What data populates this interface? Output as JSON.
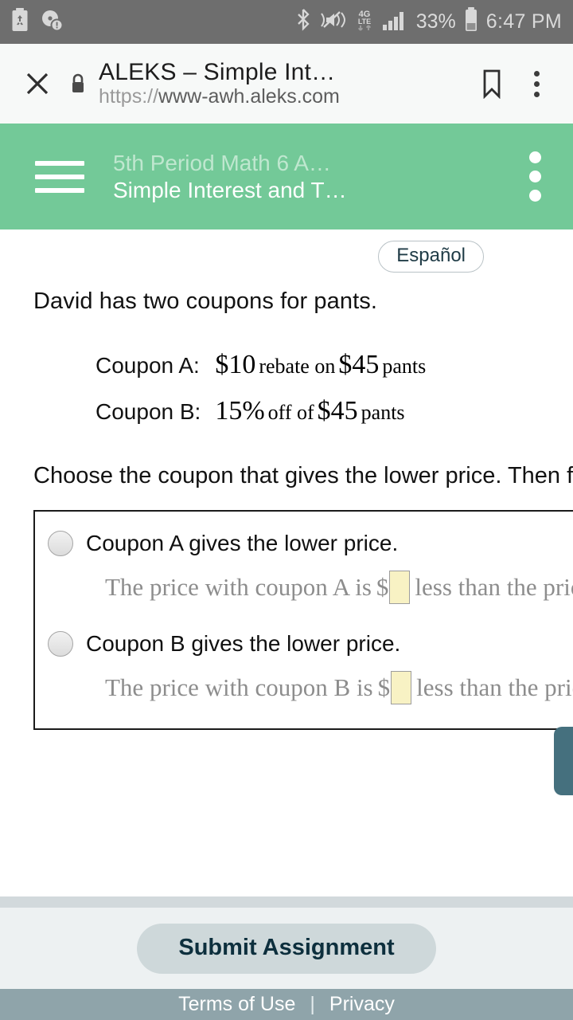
{
  "status_bar": {
    "time": "6:47 PM",
    "battery_percent": "33%",
    "network": "4G LTE",
    "left_icons": [
      "battery-saver-icon",
      "disc-warning-icon"
    ],
    "right_icons": [
      "bluetooth-icon",
      "volume-mute-vibrate-icon",
      "4g-lte-icon",
      "signal-bars-icon",
      "battery-icon"
    ],
    "background": "#6e6e6e"
  },
  "browser": {
    "close_label": "✕",
    "lock_icon": "lock-icon",
    "title": "ALEKS – Simple Int…",
    "url_scheme": "https://",
    "url_host": "www-awh.aleks.com",
    "bookmark_icon": "bookmark-icon",
    "menu_icon": "kebab-menu-icon",
    "background": "#f7f9f8"
  },
  "app_header": {
    "menu_icon": "hamburger-menu-icon",
    "course": "5th Period Math 6 A…",
    "assignment": "Simple Interest and T…",
    "overflow_icon": "kebab-menu-icon",
    "background": "#73c998"
  },
  "toolbar": {
    "espanol_label": "Español"
  },
  "problem": {
    "intro": "David has two coupons for pants.",
    "coupons": [
      {
        "label": "Coupon A:",
        "parts": [
          {
            "text": "$10",
            "size": "big"
          },
          {
            "text": "rebate on",
            "size": "sml"
          },
          {
            "text": "$45",
            "size": "big"
          },
          {
            "text": "pants",
            "size": "sml"
          }
        ]
      },
      {
        "label": "Coupon B:",
        "parts": [
          {
            "text": "15%",
            "size": "big"
          },
          {
            "text": "off of",
            "size": "sml"
          },
          {
            "text": "$45",
            "size": "big"
          },
          {
            "text": "pants",
            "size": "sml"
          }
        ]
      }
    ],
    "instruction": "Choose the coupon that gives the lower price. Then fill"
  },
  "answer": {
    "choices": [
      {
        "radio_name": "radio-coupon-a",
        "label": "Coupon A gives the lower price.",
        "fill_prefix": "The price with coupon A is",
        "dollar": "$",
        "input_value": "",
        "fill_suffix": "less than the price"
      },
      {
        "radio_name": "radio-coupon-b",
        "label": "Coupon B gives the lower price.",
        "fill_prefix": "The price with coupon B is",
        "dollar": "$",
        "input_value": "",
        "fill_suffix": "less than the price"
      }
    ]
  },
  "side_action": {
    "name": "explanation-button",
    "color": "#45707e"
  },
  "footer": {
    "submit_label": "Submit Assignment",
    "terms_label": "Terms of Use",
    "separator": "|",
    "privacy_label": "Privacy",
    "bar_color": "#8fa4aa",
    "submit_color": "#ced8da"
  }
}
